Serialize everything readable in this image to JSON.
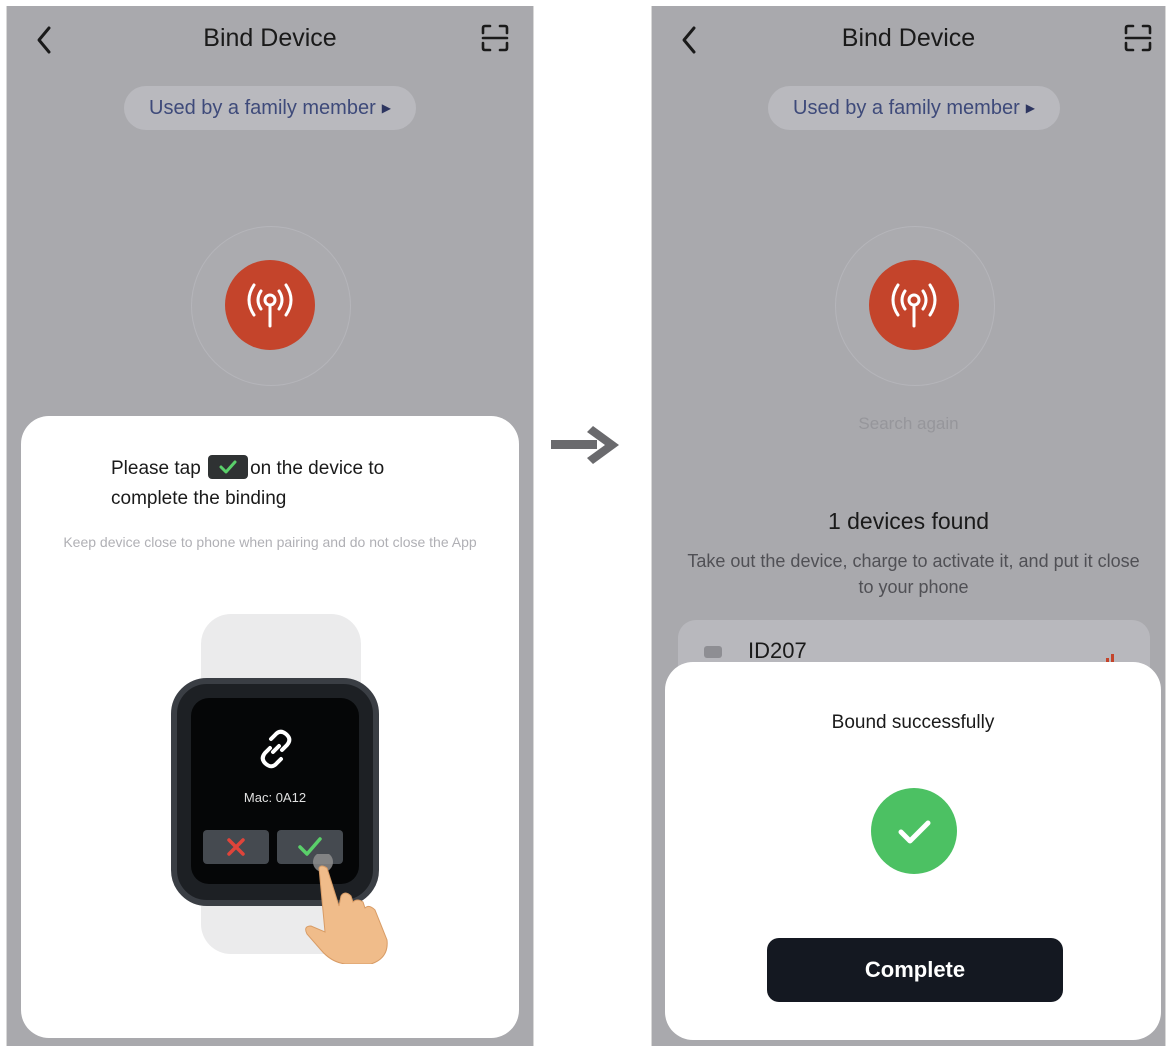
{
  "left_screen": {
    "title": "Bind Device",
    "family_member_link": "Used by a family member",
    "family_member_arrow": "▶",
    "sheet": {
      "instruction_before": "Please tap",
      "instruction_after": "on the device to complete the binding",
      "hint": "Keep device close to phone when pairing and do not close the App",
      "watch": {
        "mac_label": "Mac: 0A12"
      }
    }
  },
  "right_screen": {
    "title": "Bind Device",
    "family_member_link": "Used by a family member",
    "family_member_arrow": "▶",
    "search_again": "Search again",
    "found_title": "1 devices found",
    "found_description": "Take out the device, charge to activate it, and put it close to your phone",
    "device": {
      "name": "ID207"
    },
    "dialog": {
      "title": "Bound successfully",
      "complete_button": "Complete"
    }
  },
  "colors": {
    "radar_red": "#c4442b",
    "success_green": "#4cc163",
    "button_dark": "#141821",
    "overlay_gray": "#a9a9ad"
  },
  "icons": {
    "back": "chevron-left-icon",
    "scan": "scan-icon",
    "radar": "antenna-signal-icon",
    "link": "link-icon",
    "success": "check-icon",
    "flow": "arrow-right-icon"
  }
}
